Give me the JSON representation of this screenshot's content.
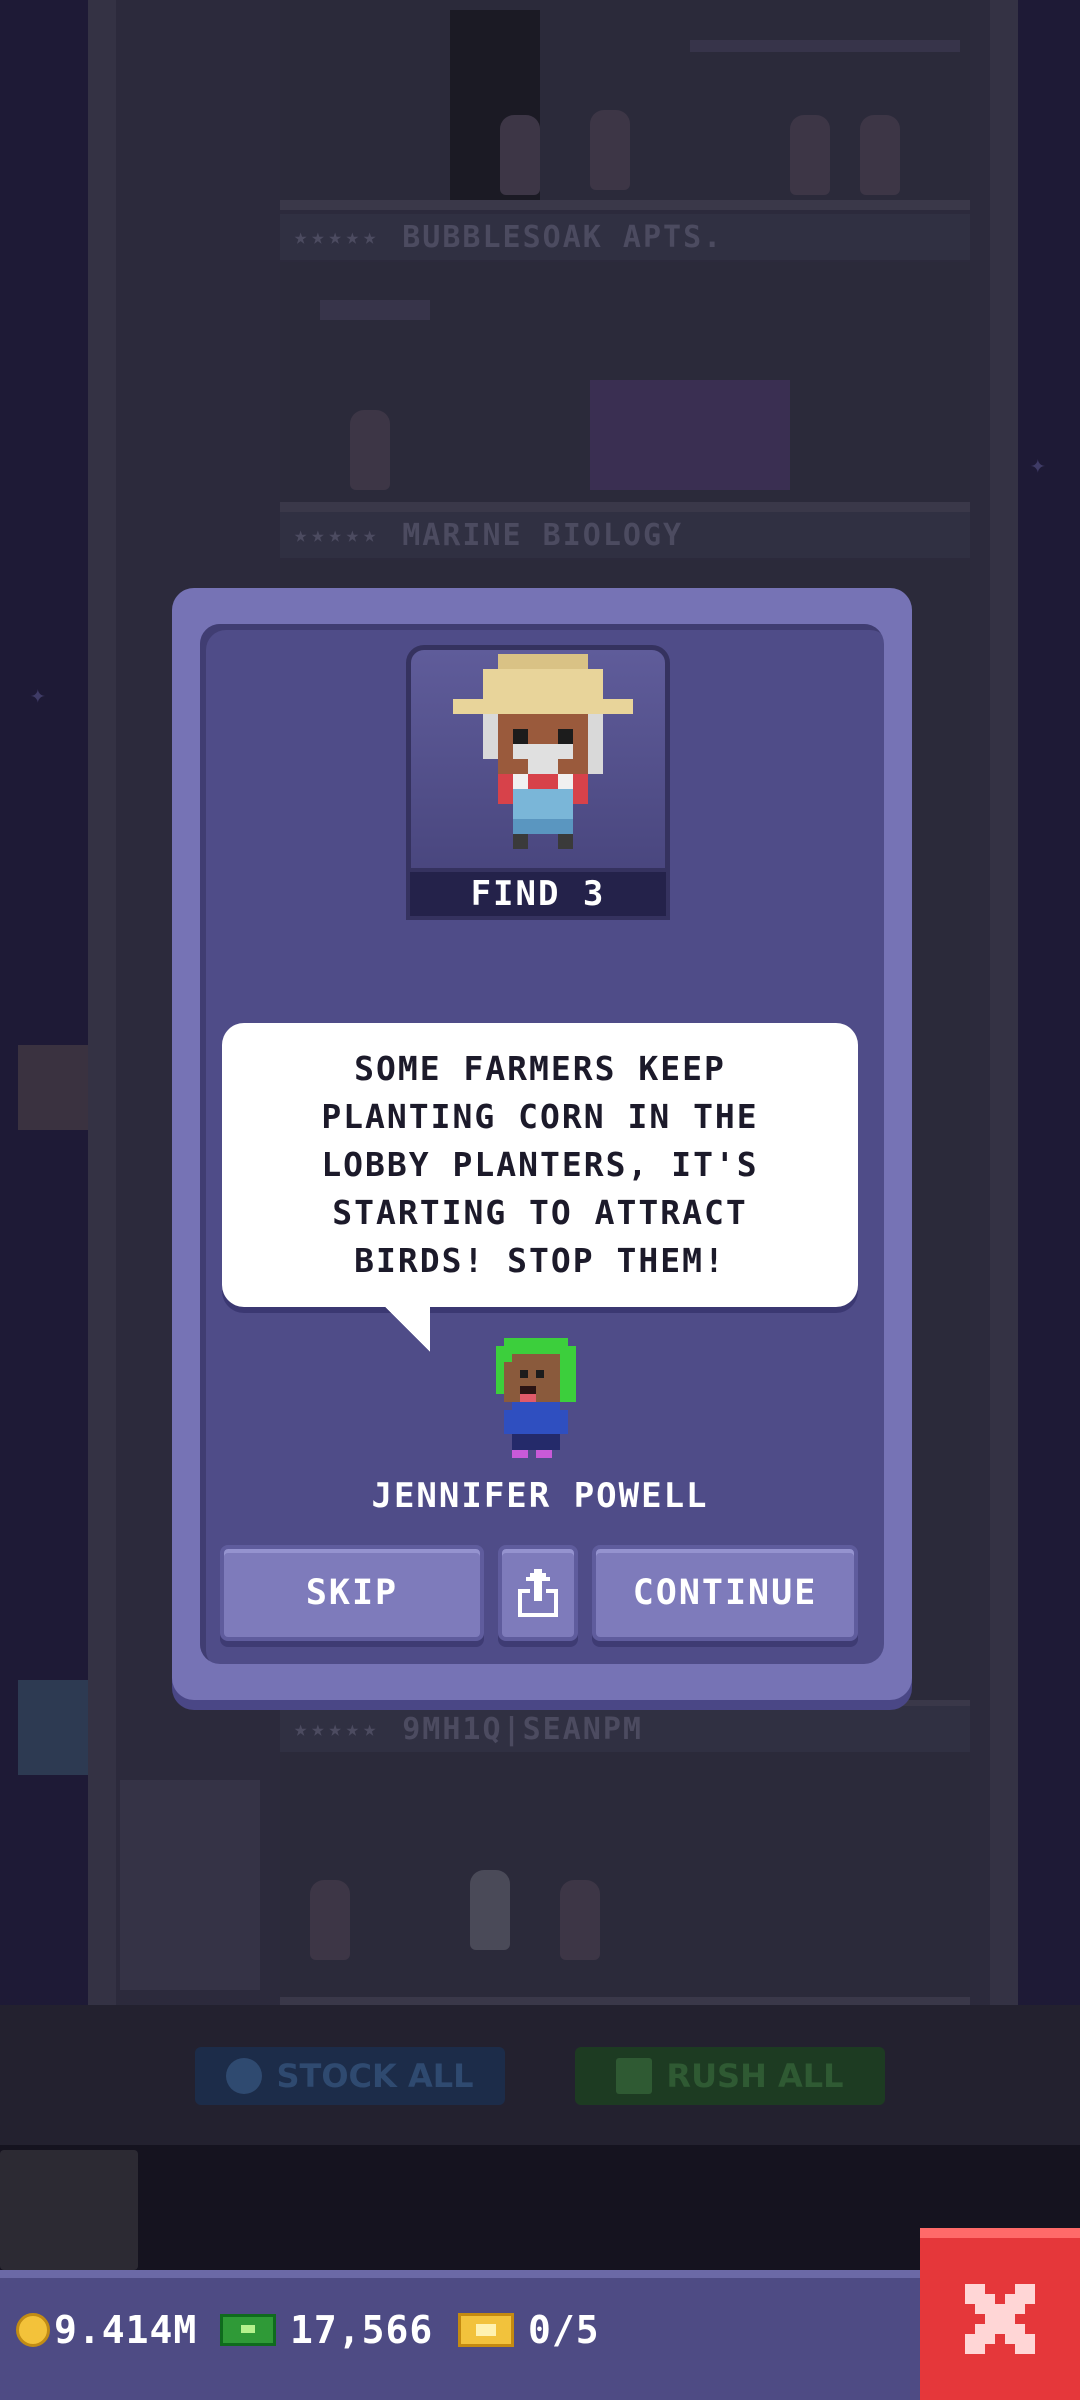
{
  "background": {
    "floors": [
      {
        "stars": "★★★★★",
        "name": "BUBBLESOAK APTS."
      },
      {
        "stars": "★★★★★",
        "name": "MARINE BIOLOGY"
      },
      {
        "stars": "★★★★★",
        "name": "9MH1Q|SEANPM"
      }
    ],
    "stock_all_label": "STOCK ALL",
    "rush_all_label": "RUSH ALL"
  },
  "dialog": {
    "find_label": "FIND 3",
    "message": "SOME FARMERS KEEP PLANTING CORN IN THE LOBBY PLANTERS, IT'S STARTING TO ATTRACT BIRDS! STOP THEM!",
    "npc_name": "JENNIFER POWELL",
    "skip_label": "SKIP",
    "continue_label": "CONTINUE"
  },
  "hud": {
    "coins": "9.414M",
    "bux": "17,566",
    "tickets": "0/5"
  },
  "colors": {
    "dialog_frame": "#7673b5",
    "dialog_inner": "#4f4c88",
    "button": "#7e7bbb",
    "hud": "#4e4b84",
    "close": "#e5373a"
  },
  "icons": [
    "coin-icon",
    "bux-icon",
    "ticket-icon",
    "close-icon",
    "share-icon",
    "clock-icon",
    "rush-icon"
  ]
}
